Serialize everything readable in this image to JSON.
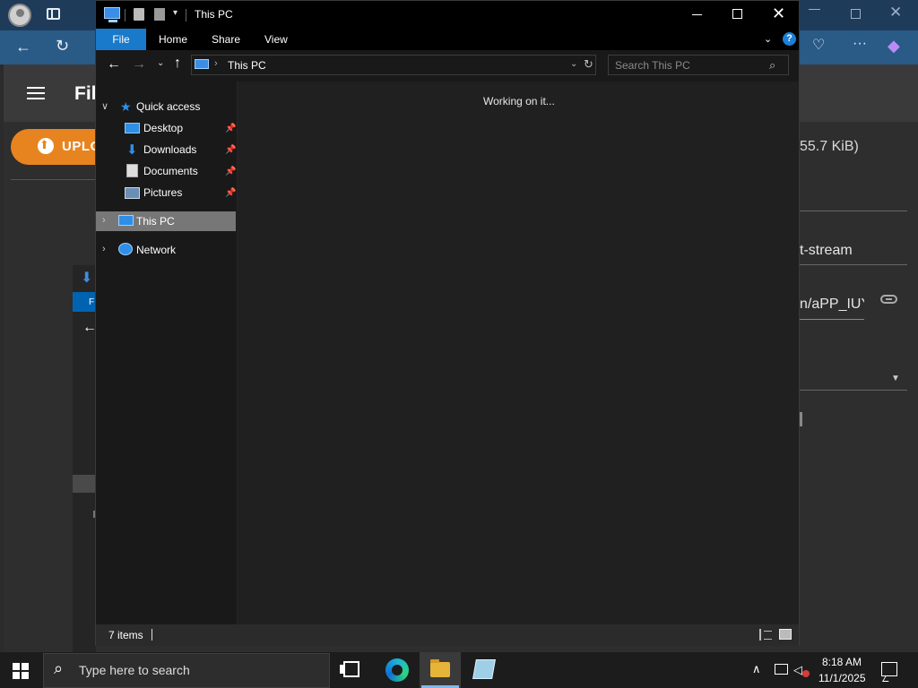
{
  "background_app": {
    "title_partial": "Fil",
    "upload_button": "UPLO",
    "file_size": "55.7 KiB)",
    "mime_type": "t-stream",
    "url_partial": "n/aPP_IUY",
    "dialog_label": "F"
  },
  "explorer": {
    "title": "This PC",
    "ribbon_tabs": [
      "File",
      "Home",
      "Share",
      "View"
    ],
    "address": "This PC",
    "search_placeholder": "Search This PC",
    "status_message": "Working on it...",
    "nav": {
      "quick_access": "Quick access",
      "desktop": "Desktop",
      "downloads": "Downloads",
      "documents": "Documents",
      "pictures": "Pictures",
      "this_pc": "This PC",
      "network": "Network"
    },
    "item_count": "7 items"
  },
  "taskbar": {
    "search_placeholder": "Type here to search",
    "time": "8:18 AM",
    "date": "11/1/2025"
  },
  "colors": {
    "accent": "#1979ca",
    "upload_orange": "#e8841f",
    "selection": "#777777"
  }
}
